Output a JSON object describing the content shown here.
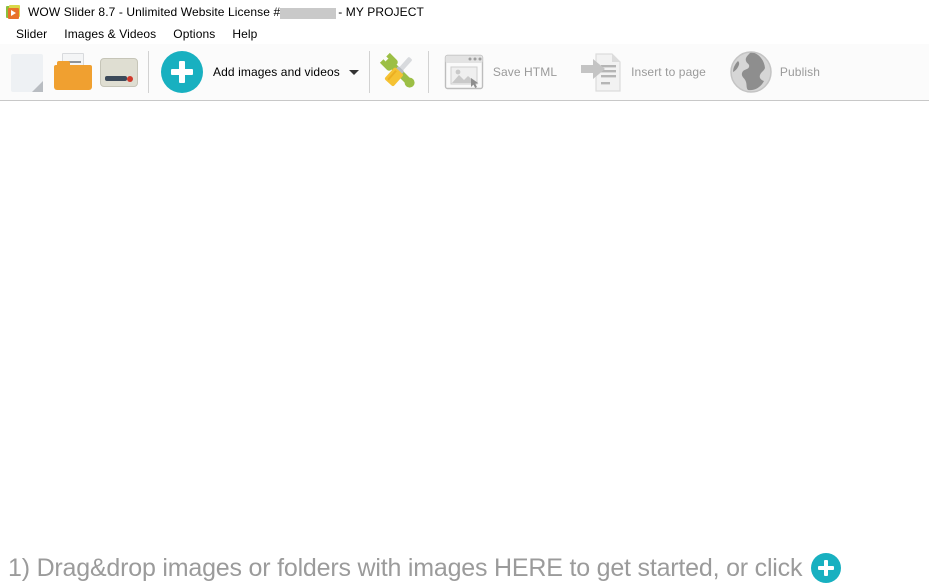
{
  "window": {
    "app_icon": "wowslider-logo-icon",
    "title_prefix": "WOW Slider 8.7 - Unlimited Website License #",
    "license_redacted": "",
    "title_suffix": "- MY PROJECT"
  },
  "menubar": {
    "items": [
      {
        "label": "Slider"
      },
      {
        "label": "Images & Videos"
      },
      {
        "label": "Options"
      },
      {
        "label": "Help"
      }
    ]
  },
  "toolbar": {
    "new_project": {
      "icon": "new-page-icon",
      "label": ""
    },
    "open_project": {
      "icon": "open-folder-icon",
      "label": ""
    },
    "save_project": {
      "icon": "disk-drive-icon",
      "label": ""
    },
    "add_images": {
      "icon": "plus-circle-icon",
      "label": "Add images and videos",
      "dropdown": "chevron-down-icon"
    },
    "tools": {
      "icon": "wrench-screwdriver-icon",
      "label": ""
    },
    "save_html": {
      "icon": "browser-window-image-icon",
      "label": "Save HTML",
      "enabled": "false"
    },
    "insert_to_page": {
      "icon": "arrow-into-document-icon",
      "label": "Insert to page",
      "enabled": "false"
    },
    "publish": {
      "icon": "globe-icon",
      "label": "Publish",
      "enabled": "false"
    }
  },
  "canvas": {
    "hint": "1) Drag&drop images or folders with images HERE to get started, or click",
    "hint_icon": "plus-circle-icon"
  },
  "colors": {
    "accent_teal": "#18b0c0",
    "folder_orange": "#f0a030",
    "wrench_green": "#9cbf45",
    "screwdriver_yellow": "#f5c233",
    "disabled_gray": "#9a9a9a",
    "hint_gray": "#9b9b9b",
    "toolbar_bg": "#fbfbfb",
    "toolbar_border": "#c8c8c8"
  }
}
